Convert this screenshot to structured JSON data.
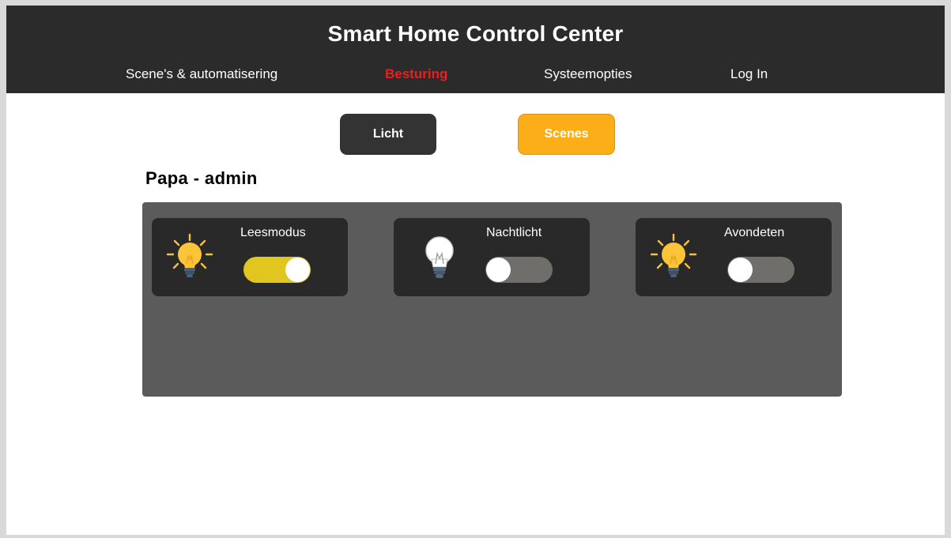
{
  "header": {
    "title": "Smart Home Control Center",
    "nav": [
      {
        "label": "Scene's & automatisering",
        "active": false
      },
      {
        "label": "Besturing",
        "active": true
      },
      {
        "label": "Systeemopties",
        "active": false
      },
      {
        "label": "Log In",
        "active": false
      }
    ]
  },
  "tabs": {
    "licht": "Licht",
    "scenes": "Scenes",
    "selected": "Scenes"
  },
  "user": {
    "label": "Papa - admin"
  },
  "scenes": [
    {
      "name": "Leesmodus",
      "on": true,
      "bulb": "bulb-lit-icon",
      "toggle_color": "#e0c61f"
    },
    {
      "name": "Nachtlicht",
      "on": false,
      "bulb": "bulb-off-icon",
      "toggle_color": "#6f6e6a"
    },
    {
      "name": "Avondeten",
      "on": false,
      "bulb": "bulb-lit-icon",
      "toggle_color": "#6f6e6a"
    }
  ],
  "colors": {
    "header_bg": "#2c2b2b",
    "active_nav": "#e52222",
    "scenes_tab": "#fbae18",
    "licht_tab": "#333333",
    "panel_bg": "#5b5b5b",
    "card_bg": "#292929",
    "toggle_on": "#e0c61f",
    "toggle_off": "#6f6e6a"
  }
}
